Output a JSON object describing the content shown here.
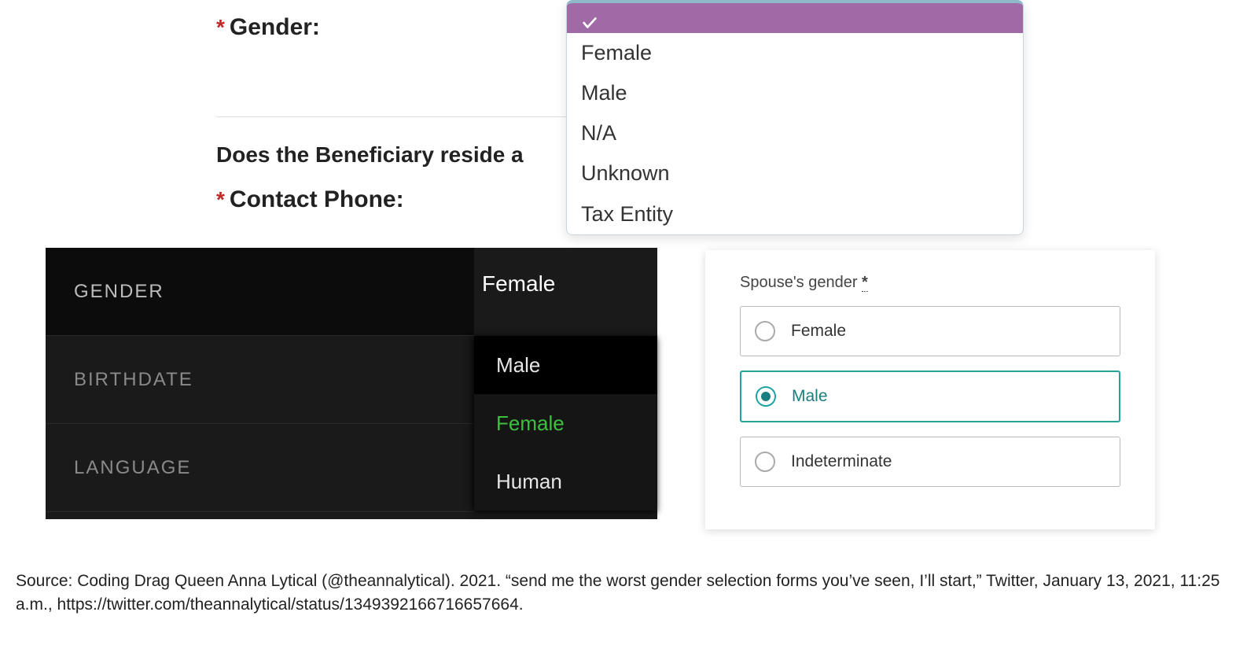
{
  "panel1": {
    "asterisk": "*",
    "gender_label": "Gender:",
    "question2": "Does the Beneficiary reside a",
    "contact_label": "Contact Phone:",
    "dropdown": {
      "opt0": "",
      "opt1": "Female",
      "opt2": "Male",
      "opt3": "N/A",
      "opt4": "Unknown",
      "opt5": "Tax Entity"
    }
  },
  "panel2": {
    "item0": "GENDER",
    "item1": "BIRTHDATE",
    "item2": "LANGUAGE",
    "current": "Female",
    "menu": {
      "m0": "Male",
      "m1": "Female",
      "m2": "Human"
    }
  },
  "panel3": {
    "title": "Spouse's gender ",
    "ast": "*",
    "opt0": "Female",
    "opt1": "Male",
    "opt2": "Indeterminate"
  },
  "caption": "Source: Coding Drag Queen Anna Lytical (@theannalytical). 2021. “send me the worst gender selection forms you’ve seen, I’ll start,” Twitter, January 13, 2021, 11:25 a.m., https://twitter.com/theannalytical/status/1349392166716657664."
}
